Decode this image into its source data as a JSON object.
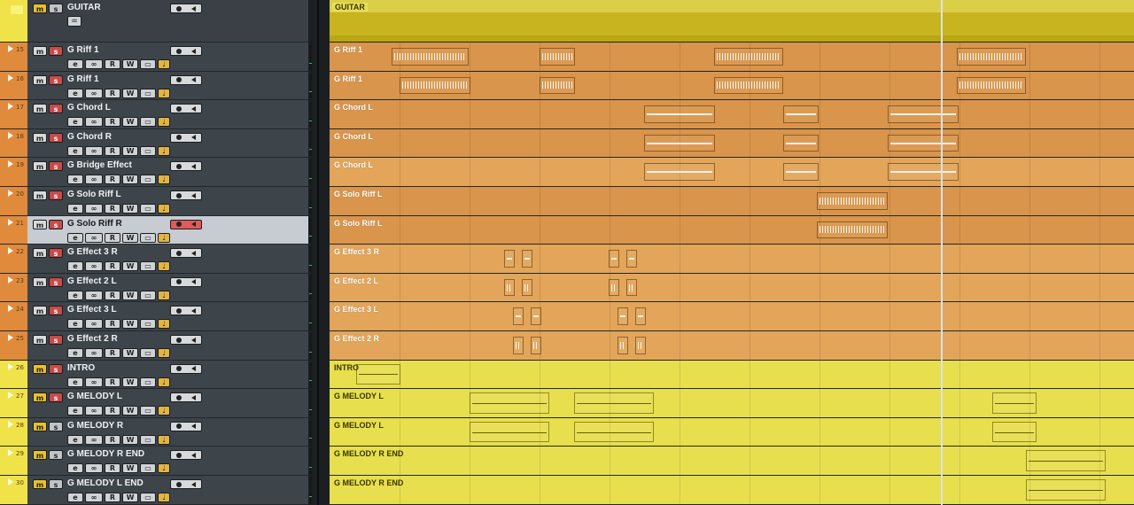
{
  "colors": {
    "folder_lane": "#d9c62e",
    "orange_lane": "#d9954b",
    "orange_lane_alt": "#d48d43",
    "light_orange_lane": "#e2a55a",
    "yellow_lane": "#e7df4e",
    "track_strip_orange": "#e08a3c",
    "track_strip_yellow": "#f0e34a",
    "selected_track_bg": "#c6ccd1"
  },
  "icons": {
    "mute": "m-button",
    "solo": "s-button",
    "record": "record-dot-icon",
    "monitor": "speaker-icon",
    "edit": "edit-icon",
    "link": "link-icon",
    "read": "read-button",
    "write": "write-button",
    "lanes": "lanes-icon",
    "note": "musical-note-icon"
  },
  "buttons": {
    "mute": "m",
    "solo": "s",
    "read": "R",
    "write": "W",
    "edit": "e",
    "link": "∞",
    "lanes": "▭",
    "note": "♩",
    "eq": "="
  },
  "folder": {
    "name": "GUITAR",
    "lane_label": "GUITAR"
  },
  "tracks": [
    {
      "num": "15",
      "name": "G Riff 1",
      "lane_label": "G Riff 1",
      "color": "orange"
    },
    {
      "num": "16",
      "name": "G Riff 1",
      "lane_label": "G Riff 1",
      "color": "orange"
    },
    {
      "num": "17",
      "name": "G Chord L",
      "lane_label": "G Chord L",
      "color": "orange"
    },
    {
      "num": "18",
      "name": "G Chord R",
      "lane_label": "G Chord L",
      "color": "orange"
    },
    {
      "num": "19",
      "name": "G Bridge Effect",
      "lane_label": "G Chord L",
      "color": "lightorange"
    },
    {
      "num": "20",
      "name": "G Solo Riff L",
      "lane_label": "G Solo Riff L",
      "color": "orange"
    },
    {
      "num": "21",
      "name": "G Solo Riff R",
      "lane_label": "G Solo Riff L",
      "color": "orange",
      "selected": true
    },
    {
      "num": "22",
      "name": "G Effect 3 R",
      "lane_label": "G Effect 3 R",
      "color": "lightorange"
    },
    {
      "num": "23",
      "name": "G Effect 2 L",
      "lane_label": "G Effect 2 L",
      "color": "lightorange"
    },
    {
      "num": "24",
      "name": "G Effect 3 L",
      "lane_label": "G Effect 3 L",
      "color": "lightorange"
    },
    {
      "num": "25",
      "name": "G Effect 2 R",
      "lane_label": "G Effect 2 R",
      "color": "lightorange"
    },
    {
      "num": "26",
      "name": "INTRO",
      "lane_label": "INTRO",
      "color": "yellow"
    },
    {
      "num": "27",
      "name": "G MELODY L",
      "lane_label": "G MELODY L",
      "color": "yellow"
    },
    {
      "num": "28",
      "name": "G MELODY R",
      "lane_label": "G MELODY L",
      "color": "yellow"
    },
    {
      "num": "29",
      "name": "G MELODY R END",
      "lane_label": "G MELODY R END",
      "color": "yellow"
    },
    {
      "num": "30",
      "name": "G MELODY L END",
      "lane_label": "G MELODY R END",
      "color": "yellow"
    }
  ]
}
